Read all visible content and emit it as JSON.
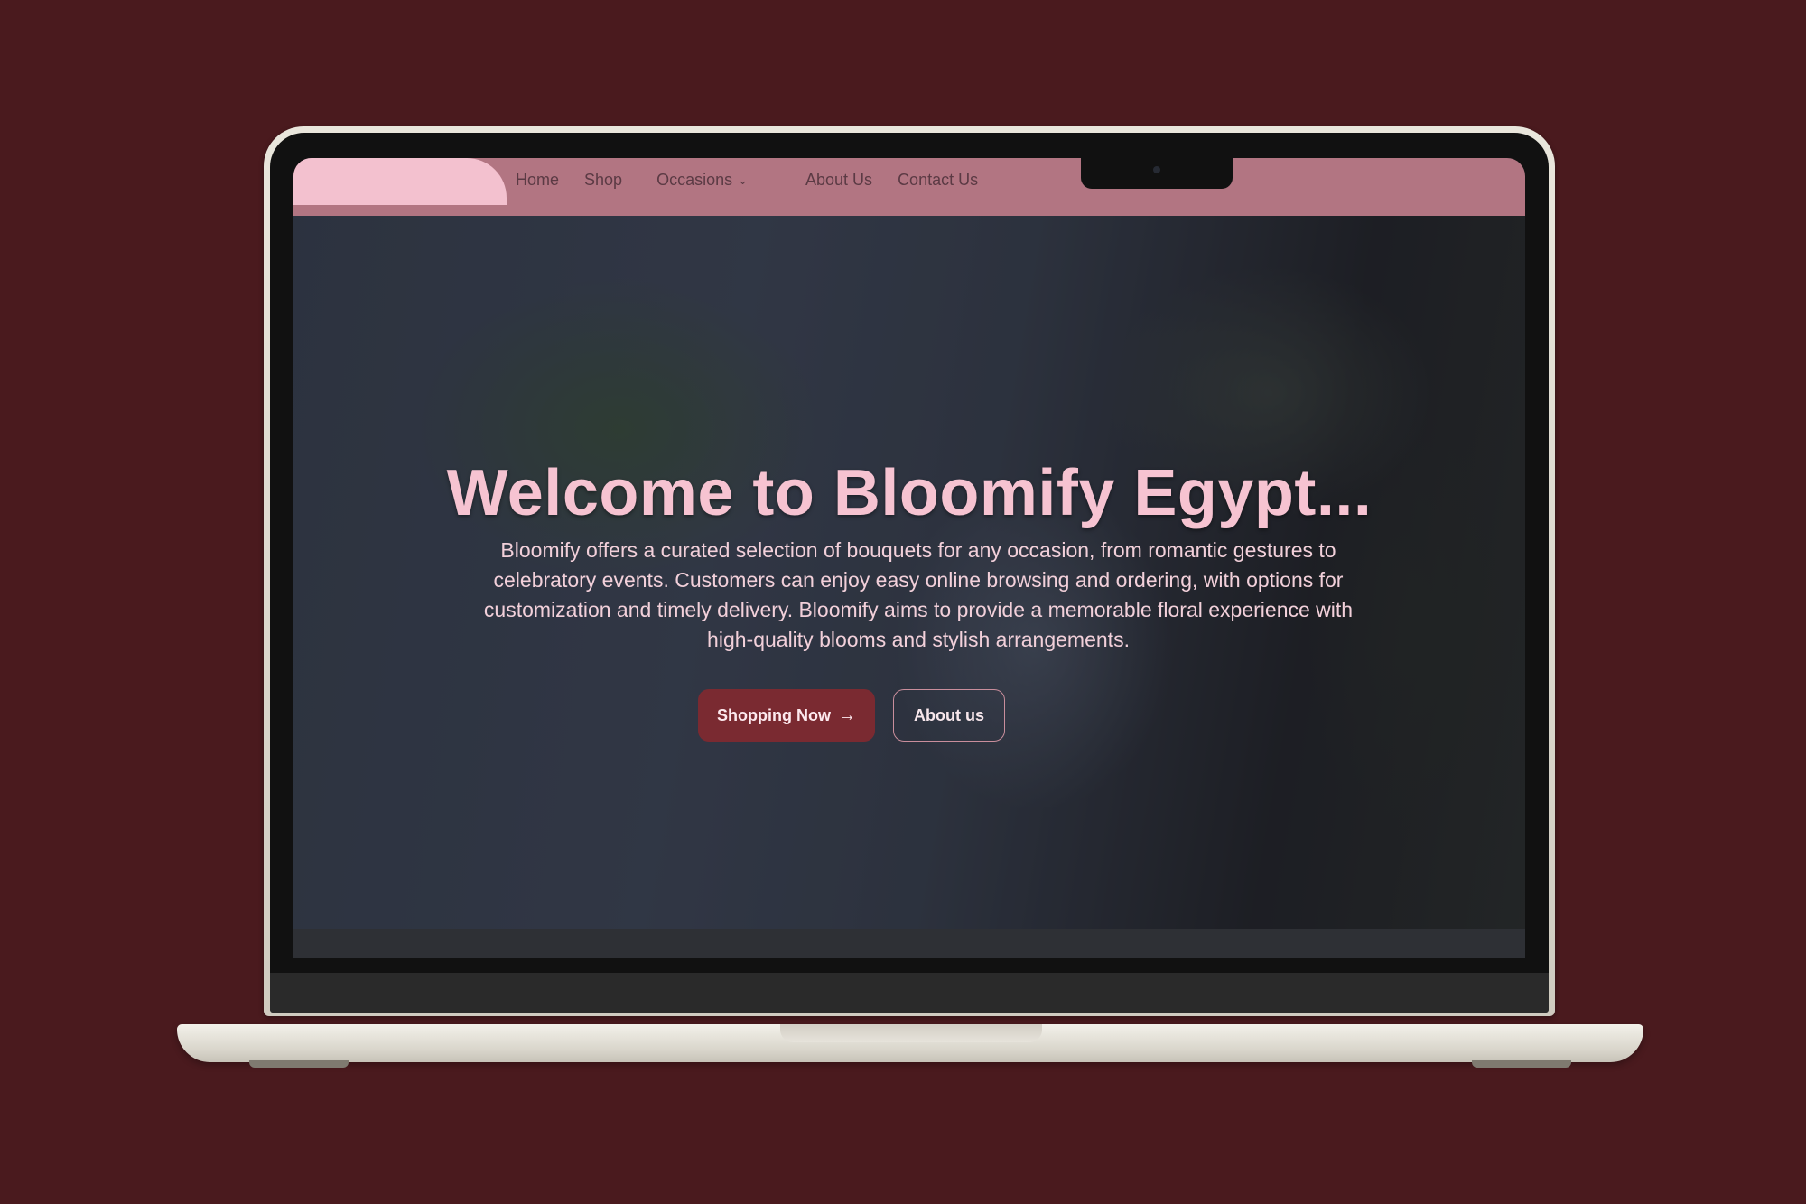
{
  "nav": {
    "items": [
      "Home",
      "Shop",
      "Occasions",
      "About Us",
      "Contact Us"
    ]
  },
  "hero": {
    "title": "Welcome to Bloomify Egypt...",
    "description": "Bloomify offers a curated selection of bouquets for any occasion, from romantic gestures to celebratory events. Customers can enjoy easy online browsing and ordering, with options for customization and timely delivery. Bloomify aims to provide a memorable floral experience with high-quality blooms and stylish arrangements.",
    "primary_button": "Shopping Now",
    "secondary_button": "About us"
  },
  "icons": {
    "occasions_chevron": "chevron-down-icon",
    "shopping_arrow": "arrow-right-icon"
  },
  "colors": {
    "background": "#4a1a1e",
    "navbar": "#b27582",
    "logo_tab": "#f3c1cf",
    "title": "#f6c3d1",
    "primary_button": "#7a2a31"
  }
}
